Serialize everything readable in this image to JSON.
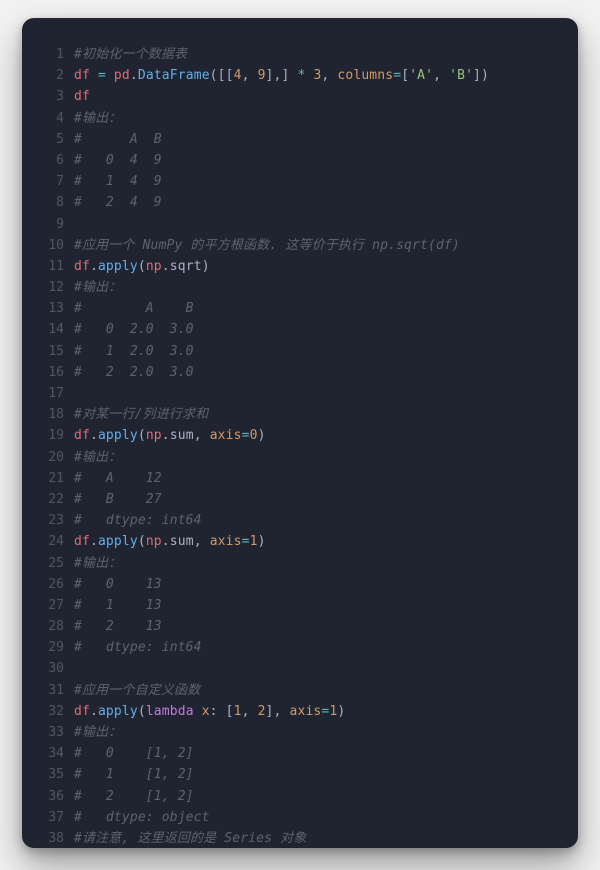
{
  "theme": {
    "background": "#1f2430",
    "page_bg": "#f2f2f2",
    "lineno_color": "#4f5666",
    "comment": "#5c6370",
    "identifier": "#e06c75",
    "operator": "#56b6c2",
    "punctuation": "#abb2bf",
    "number": "#d19a66",
    "string": "#98c379",
    "function": "#61afef",
    "keyword": "#c678dd",
    "plain": "#abb2bf"
  },
  "language": "python",
  "lines": [
    {
      "n": 1,
      "tokens": [
        {
          "t": "#初始化一个数据表",
          "c": "comment"
        }
      ]
    },
    {
      "n": 2,
      "tokens": [
        {
          "t": "df",
          "c": "var"
        },
        {
          "t": " ",
          "c": "plain"
        },
        {
          "t": "=",
          "c": "op"
        },
        {
          "t": " ",
          "c": "plain"
        },
        {
          "t": "pd",
          "c": "var"
        },
        {
          "t": ".",
          "c": "punct"
        },
        {
          "t": "DataFrame",
          "c": "call"
        },
        {
          "t": "([[",
          "c": "punct"
        },
        {
          "t": "4",
          "c": "num"
        },
        {
          "t": ", ",
          "c": "punct"
        },
        {
          "t": "9",
          "c": "num"
        },
        {
          "t": "],] ",
          "c": "punct"
        },
        {
          "t": "*",
          "c": "op"
        },
        {
          "t": " ",
          "c": "plain"
        },
        {
          "t": "3",
          "c": "num"
        },
        {
          "t": ", ",
          "c": "punct"
        },
        {
          "t": "columns",
          "c": "param"
        },
        {
          "t": "=",
          "c": "op"
        },
        {
          "t": "[",
          "c": "punct"
        },
        {
          "t": "'A'",
          "c": "str"
        },
        {
          "t": ", ",
          "c": "punct"
        },
        {
          "t": "'B'",
          "c": "str"
        },
        {
          "t": "])",
          "c": "punct"
        }
      ]
    },
    {
      "n": 3,
      "tokens": [
        {
          "t": "df",
          "c": "var"
        }
      ]
    },
    {
      "n": 4,
      "tokens": [
        {
          "t": "#输出：",
          "c": "comment"
        }
      ]
    },
    {
      "n": 5,
      "tokens": [
        {
          "t": "#      A  B",
          "c": "comment"
        }
      ]
    },
    {
      "n": 6,
      "tokens": [
        {
          "t": "#   0  4  9",
          "c": "comment"
        }
      ]
    },
    {
      "n": 7,
      "tokens": [
        {
          "t": "#   1  4  9",
          "c": "comment"
        }
      ]
    },
    {
      "n": 8,
      "tokens": [
        {
          "t": "#   2  4  9",
          "c": "comment"
        }
      ]
    },
    {
      "n": 9,
      "tokens": []
    },
    {
      "n": 10,
      "tokens": [
        {
          "t": "#应用一个 NumPy 的平方根函数. 这等价于执行 np.sqrt(df)",
          "c": "comment"
        }
      ]
    },
    {
      "n": 11,
      "tokens": [
        {
          "t": "df",
          "c": "var"
        },
        {
          "t": ".",
          "c": "punct"
        },
        {
          "t": "apply",
          "c": "call"
        },
        {
          "t": "(",
          "c": "punct"
        },
        {
          "t": "np",
          "c": "var"
        },
        {
          "t": ".",
          "c": "punct"
        },
        {
          "t": "sqrt",
          "c": "plain"
        },
        {
          "t": ")",
          "c": "punct"
        }
      ]
    },
    {
      "n": 12,
      "tokens": [
        {
          "t": "#输出：",
          "c": "comment"
        }
      ]
    },
    {
      "n": 13,
      "tokens": [
        {
          "t": "#        A    B",
          "c": "comment"
        }
      ]
    },
    {
      "n": 14,
      "tokens": [
        {
          "t": "#   0  2.0  3.0",
          "c": "comment"
        }
      ]
    },
    {
      "n": 15,
      "tokens": [
        {
          "t": "#   1  2.0  3.0",
          "c": "comment"
        }
      ]
    },
    {
      "n": 16,
      "tokens": [
        {
          "t": "#   2  2.0  3.0",
          "c": "comment"
        }
      ]
    },
    {
      "n": 17,
      "tokens": []
    },
    {
      "n": 18,
      "tokens": [
        {
          "t": "#对某一行/列进行求和",
          "c": "comment"
        }
      ]
    },
    {
      "n": 19,
      "tokens": [
        {
          "t": "df",
          "c": "var"
        },
        {
          "t": ".",
          "c": "punct"
        },
        {
          "t": "apply",
          "c": "call"
        },
        {
          "t": "(",
          "c": "punct"
        },
        {
          "t": "np",
          "c": "var"
        },
        {
          "t": ".",
          "c": "punct"
        },
        {
          "t": "sum",
          "c": "plain"
        },
        {
          "t": ", ",
          "c": "punct"
        },
        {
          "t": "axis",
          "c": "param"
        },
        {
          "t": "=",
          "c": "op"
        },
        {
          "t": "0",
          "c": "num"
        },
        {
          "t": ")",
          "c": "punct"
        }
      ]
    },
    {
      "n": 20,
      "tokens": [
        {
          "t": "#输出：",
          "c": "comment"
        }
      ]
    },
    {
      "n": 21,
      "tokens": [
        {
          "t": "#   A    12",
          "c": "comment"
        }
      ]
    },
    {
      "n": 22,
      "tokens": [
        {
          "t": "#   B    27",
          "c": "comment"
        }
      ]
    },
    {
      "n": 23,
      "tokens": [
        {
          "t": "#   dtype: int64",
          "c": "comment"
        }
      ]
    },
    {
      "n": 24,
      "tokens": [
        {
          "t": "df",
          "c": "var"
        },
        {
          "t": ".",
          "c": "punct"
        },
        {
          "t": "apply",
          "c": "call"
        },
        {
          "t": "(",
          "c": "punct"
        },
        {
          "t": "np",
          "c": "var"
        },
        {
          "t": ".",
          "c": "punct"
        },
        {
          "t": "sum",
          "c": "plain"
        },
        {
          "t": ", ",
          "c": "punct"
        },
        {
          "t": "axis",
          "c": "param"
        },
        {
          "t": "=",
          "c": "op"
        },
        {
          "t": "1",
          "c": "num"
        },
        {
          "t": ")",
          "c": "punct"
        }
      ]
    },
    {
      "n": 25,
      "tokens": [
        {
          "t": "#输出：",
          "c": "comment"
        }
      ]
    },
    {
      "n": 26,
      "tokens": [
        {
          "t": "#   0    13",
          "c": "comment"
        }
      ]
    },
    {
      "n": 27,
      "tokens": [
        {
          "t": "#   1    13",
          "c": "comment"
        }
      ]
    },
    {
      "n": 28,
      "tokens": [
        {
          "t": "#   2    13",
          "c": "comment"
        }
      ]
    },
    {
      "n": 29,
      "tokens": [
        {
          "t": "#   dtype: int64",
          "c": "comment"
        }
      ]
    },
    {
      "n": 30,
      "tokens": []
    },
    {
      "n": 31,
      "tokens": [
        {
          "t": "#应用一个自定义函数",
          "c": "comment"
        }
      ]
    },
    {
      "n": 32,
      "tokens": [
        {
          "t": "df",
          "c": "var"
        },
        {
          "t": ".",
          "c": "punct"
        },
        {
          "t": "apply",
          "c": "call"
        },
        {
          "t": "(",
          "c": "punct"
        },
        {
          "t": "lambda",
          "c": "kw"
        },
        {
          "t": " ",
          "c": "plain"
        },
        {
          "t": "x",
          "c": "param"
        },
        {
          "t": ": [",
          "c": "punct"
        },
        {
          "t": "1",
          "c": "num"
        },
        {
          "t": ", ",
          "c": "punct"
        },
        {
          "t": "2",
          "c": "num"
        },
        {
          "t": "], ",
          "c": "punct"
        },
        {
          "t": "axis",
          "c": "param"
        },
        {
          "t": "=",
          "c": "op"
        },
        {
          "t": "1",
          "c": "num"
        },
        {
          "t": ")",
          "c": "punct"
        }
      ]
    },
    {
      "n": 33,
      "tokens": [
        {
          "t": "#输出：",
          "c": "comment"
        }
      ]
    },
    {
      "n": 34,
      "tokens": [
        {
          "t": "#   0    [1, 2]",
          "c": "comment"
        }
      ]
    },
    {
      "n": 35,
      "tokens": [
        {
          "t": "#   1    [1, 2]",
          "c": "comment"
        }
      ]
    },
    {
      "n": 36,
      "tokens": [
        {
          "t": "#   2    [1, 2]",
          "c": "comment"
        }
      ]
    },
    {
      "n": 37,
      "tokens": [
        {
          "t": "#   dtype: object",
          "c": "comment"
        }
      ]
    },
    {
      "n": 38,
      "tokens": [
        {
          "t": "#请注意, 这里返回的是 Series 对象",
          "c": "comment"
        }
      ]
    }
  ]
}
